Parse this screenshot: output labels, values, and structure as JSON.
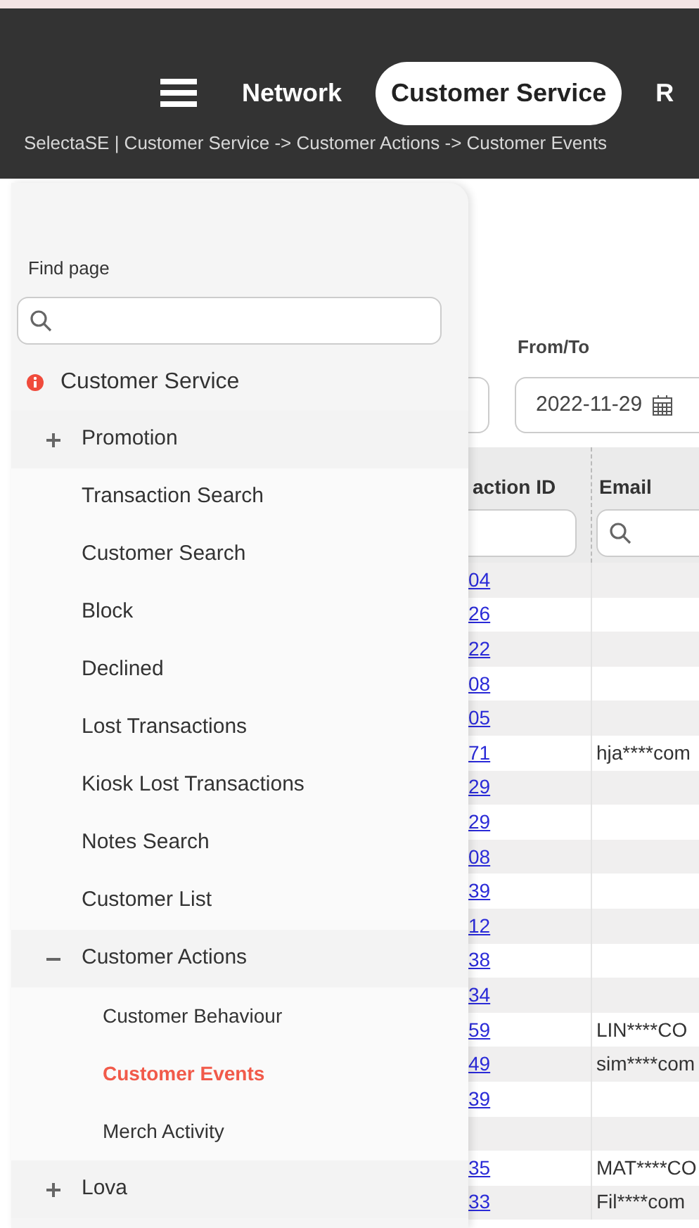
{
  "header": {
    "nav": [
      {
        "label": "Network",
        "selected": false
      },
      {
        "label": "Customer Service",
        "selected": true
      },
      {
        "label": "R",
        "selected": false
      }
    ],
    "breadcrumb": "SelectaSE | Customer Service -> Customer Actions -> Customer Events"
  },
  "filters": {
    "label": "From/To",
    "to_value": "2022-11-29"
  },
  "table": {
    "columns": [
      "action ID",
      "Email"
    ],
    "rows": [
      {
        "id": "04"
      },
      {
        "id": "26"
      },
      {
        "id": "22"
      },
      {
        "id": "08"
      },
      {
        "id": "05"
      },
      {
        "id": "71",
        "email": "hja****com"
      },
      {
        "id": "29"
      },
      {
        "id": "29"
      },
      {
        "id": "08"
      },
      {
        "id": "39"
      },
      {
        "id": "12"
      },
      {
        "id": "38"
      },
      {
        "id": "34"
      },
      {
        "id": "59",
        "email": "LIN****CO"
      },
      {
        "id": "49",
        "email": "sim****com"
      },
      {
        "id": "39"
      },
      {},
      {
        "id": "35",
        "email": "MAT****CO"
      },
      {
        "id": "33",
        "email": "Fil****com"
      }
    ]
  },
  "sidebar": {
    "search_label": "Find page",
    "tree": [
      {
        "label": "Customer Service",
        "alert": true,
        "children": [
          {
            "label": "Promotion",
            "expanded": false,
            "selected": false
          },
          {
            "label": "Transaction Search",
            "selected": false
          },
          {
            "label": "Customer Search",
            "selected": false
          },
          {
            "label": "Block",
            "selected": false
          },
          {
            "label": "Declined",
            "selected": false
          },
          {
            "label": "Lost Transactions",
            "selected": false
          },
          {
            "label": "Kiosk Lost Transactions",
            "selected": false
          },
          {
            "label": "Notes Search",
            "selected": false
          },
          {
            "label": "Customer List",
            "selected": false
          },
          {
            "label": "Customer Actions",
            "expanded": true,
            "selected": false,
            "children": [
              {
                "label": "Customer Behaviour",
                "selected": false
              },
              {
                "label": "Customer Events",
                "selected": true
              },
              {
                "label": "Merch Activity",
                "selected": false
              }
            ]
          },
          {
            "label": "Lova",
            "expanded": false,
            "selected": false
          }
        ]
      }
    ]
  }
}
